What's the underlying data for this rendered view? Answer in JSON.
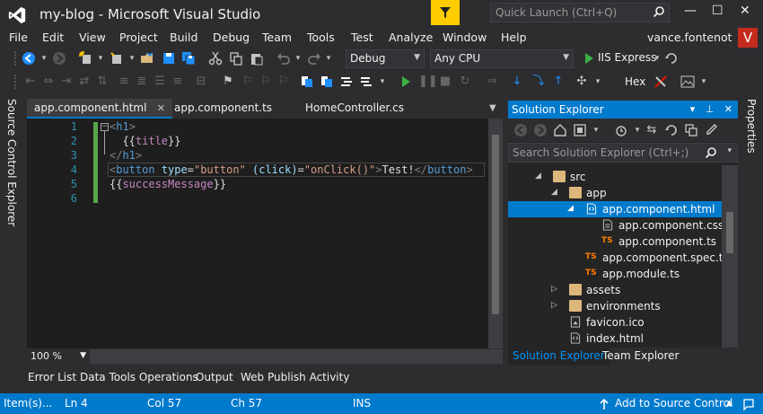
{
  "window": {
    "title": "my-blog - Microsoft Visual Studio"
  },
  "quick_launch": {
    "placeholder": "Quick Launch (Ctrl+Q)"
  },
  "window_controls": {
    "minimize": "—",
    "maximize": "☐",
    "close": "✕"
  },
  "menu": [
    "File",
    "Edit",
    "View",
    "Project",
    "Build",
    "Debug",
    "Team",
    "Tools",
    "Test",
    "Analyze",
    "Window",
    "Help"
  ],
  "user": {
    "name": "vance.fontenot",
    "initial": "V"
  },
  "toolbar": {
    "configuration": "Debug",
    "platform": "Any CPU",
    "run_target": "IIS Express",
    "hex_label": "Hex"
  },
  "left_strip": {
    "label": "Source Control Explorer"
  },
  "right_strip": {
    "label": "Properties"
  },
  "editor_tabs": [
    {
      "label": "app.component.html",
      "active": true
    },
    {
      "label": "app.component.ts",
      "active": false
    },
    {
      "label": "HomeController.cs",
      "active": false
    }
  ],
  "editor": {
    "line_numbers": [
      "1",
      "2",
      "3",
      "4",
      "5",
      "6"
    ],
    "zoom": "100 %"
  },
  "bottom_tabs": [
    "Error List",
    "Data Tools Operations",
    "Output",
    "Web Publish Activity"
  ],
  "solution_explorer": {
    "title": "Solution Explorer",
    "search_placeholder": "Search Solution Explorer (Ctrl+;)",
    "nodes": [
      {
        "label": "src",
        "kind": "folder-open"
      },
      {
        "label": "app",
        "kind": "folder-open"
      },
      {
        "label": "app.component.html",
        "kind": "html",
        "selected": true
      },
      {
        "label": "app.component.css",
        "kind": "css"
      },
      {
        "label": "app.component.ts",
        "kind": "ts"
      },
      {
        "label": "app.component.spec.ts",
        "kind": "ts"
      },
      {
        "label": "app.module.ts",
        "kind": "ts"
      },
      {
        "label": "assets",
        "kind": "folder"
      },
      {
        "label": "environments",
        "kind": "folder"
      },
      {
        "label": "favicon.ico",
        "kind": "ico"
      },
      {
        "label": "index.html",
        "kind": "html"
      }
    ],
    "ts_badge": "TS",
    "bottom_tabs": [
      {
        "label": "Solution Explorer",
        "active": true
      },
      {
        "label": "Team Explorer",
        "active": false
      }
    ]
  },
  "status": {
    "items": "Item(s)...",
    "ln": "Ln 4",
    "col": "Col 57",
    "ch": "Ch 57",
    "mode": "INS",
    "source_control": "Add to Source Control"
  },
  "colors": {
    "accent": "#007acc",
    "brand": "#68217a",
    "filter": "#ffcc00",
    "badge": "#c42b1c"
  }
}
